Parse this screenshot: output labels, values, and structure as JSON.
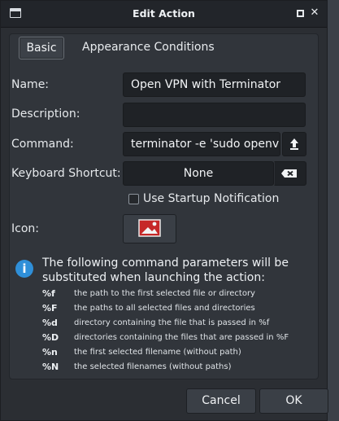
{
  "window": {
    "title": "Edit Action"
  },
  "tabs": [
    {
      "label": "Basic",
      "selected": true
    },
    {
      "label": "Appearance Conditions",
      "selected": false
    }
  ],
  "form": {
    "name_label": "Name:",
    "name_value": "Open VPN with Terminator",
    "description_label": "Description:",
    "description_value": "",
    "command_label": "Command:",
    "command_value": "terminator -e 'sudo openvp",
    "shortcut_label": "Keyboard Shortcut:",
    "shortcut_value": "None",
    "startup_notification_label": "Use Startup Notification",
    "startup_notification_checked": false,
    "icon_label": "Icon:"
  },
  "info": {
    "text": "The following command parameters will be substituted when launching the action:",
    "params": [
      {
        "key": "%f",
        "desc": "the path to the first selected file or directory"
      },
      {
        "key": "%F",
        "desc": "the paths to all selected files and directories"
      },
      {
        "key": "%d",
        "desc": "directory containing the file that is passed in %f"
      },
      {
        "key": "%D",
        "desc": "directories containing the files that are passed in %F"
      },
      {
        "key": "%n",
        "desc": "the first selected filename (without path)"
      },
      {
        "key": "%N",
        "desc": "the selected filenames (without paths)"
      }
    ]
  },
  "buttons": {
    "cancel": "Cancel",
    "ok": "OK"
  },
  "colors": {
    "window_bg": "#2b2e33",
    "entry_bg": "#1f2226",
    "info_blue": "#2f8fd8"
  }
}
